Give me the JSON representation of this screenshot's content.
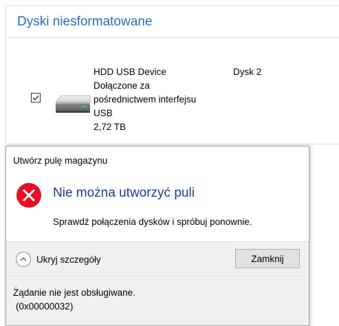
{
  "drives_panel": {
    "title": "Dyski niesformatowane",
    "drive": {
      "checked": true,
      "name": "HDD USB Device",
      "connection_line1": "Dołączone za",
      "connection_line2": "pośrednictwem interfejsu",
      "connection_line3": "USB",
      "size": "2,72 TB",
      "disk": "Dysk 2"
    }
  },
  "dialog": {
    "title": "Utwórz pulę magazynu",
    "icon": "error-icon",
    "heading": "Nie można utworzyć puli",
    "message": "Sprawdź połączenia dysków i spróbuj ponownie.",
    "toggle_label": "Ukryj szczegóły",
    "close_label": "Zamknij",
    "details_line1": "Żądanie nie jest obsługiwane.",
    "details_line2": "(0x00000032)"
  },
  "colors": {
    "accent_title": "#1e6fb8",
    "error_heading": "#1a3c8c",
    "error_red": "#e81123",
    "footer_bg": "#f0f0f0"
  }
}
